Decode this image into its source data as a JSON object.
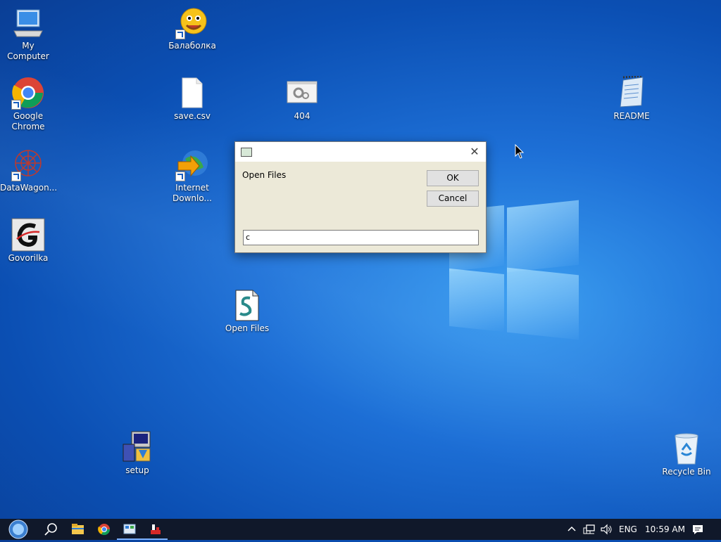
{
  "desktop": {
    "icons": [
      {
        "label": "My Computer"
      },
      {
        "label": "Балаболка"
      },
      {
        "label": "Google Chrome"
      },
      {
        "label": "save.csv"
      },
      {
        "label": "404"
      },
      {
        "label": "README"
      },
      {
        "label": "DataWagon..."
      },
      {
        "label": "Internet Downlo..."
      },
      {
        "label": "Govorilka"
      },
      {
        "label": "Open Files"
      },
      {
        "label": "setup"
      },
      {
        "label": "Recycle Bin"
      }
    ]
  },
  "dialog": {
    "prompt": "Open Files",
    "ok_label": "OK",
    "cancel_label": "Cancel",
    "input_value": "c",
    "close_glyph": "✕"
  },
  "taskbar": {
    "lang": "ENG",
    "time": "10:59 AM",
    "icons": [
      "start-orb-icon",
      "search-icon",
      "file-explorer-icon",
      "chrome-icon",
      "control-panel-icon",
      "app-icon"
    ]
  },
  "colors": {
    "taskbar_bg": "#10182a",
    "desktop_accent": "#1d6fd6"
  }
}
